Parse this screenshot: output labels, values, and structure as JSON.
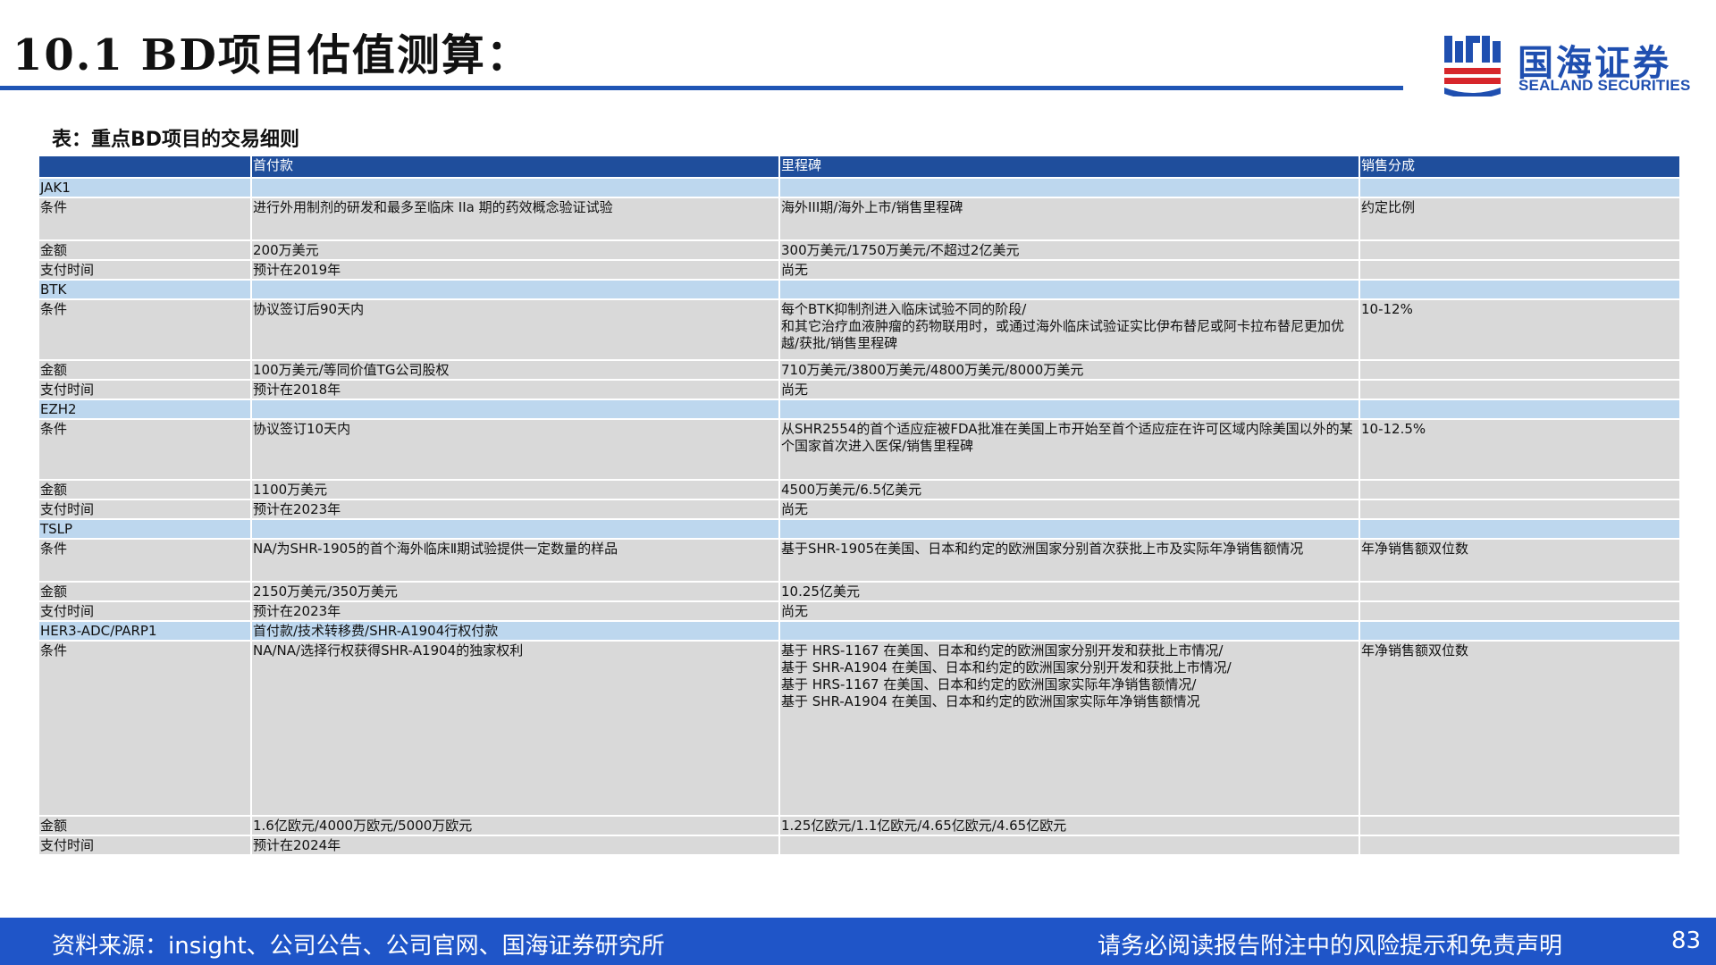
{
  "page": {
    "title": "10.1 BD项目估值测算：",
    "page_number": "83"
  },
  "logo": {
    "cn": "国海证券",
    "en": "SEALAND SECURITIES"
  },
  "table": {
    "caption": "表：重点BD项目的交易细则",
    "headers": [
      "",
      "首付款",
      "里程碑",
      "销售分成"
    ],
    "rows": [
      {
        "kind": "target",
        "cells": [
          "JAK1",
          "",
          "",
          ""
        ]
      },
      {
        "kind": "detail",
        "cells": [
          "条件",
          "进行外用制剂的研发和最多至临床 IIa 期的药效概念验证试验",
          "海外III期/海外上市/销售里程碑",
          "约定比例"
        ]
      },
      {
        "kind": "detail",
        "cells": [
          "金额",
          "200万美元",
          "300万美元/1750万美元/不超过2亿美元",
          ""
        ]
      },
      {
        "kind": "detail",
        "cells": [
          "支付时间",
          "预计在2019年",
          "尚无",
          ""
        ]
      },
      {
        "kind": "target",
        "cells": [
          "BTK",
          "",
          "",
          ""
        ]
      },
      {
        "kind": "detail",
        "cells": [
          "条件",
          "协议签订后90天内",
          "每个BTK抑制剂进入临床试验不同的阶段/\n和其它治疗血液肿瘤的药物联用时，或通过海外临床试验证实比伊布替尼或阿卡拉布替尼更加优越/获批/销售里程碑",
          "10-12%"
        ]
      },
      {
        "kind": "detail",
        "cells": [
          "金额",
          "100万美元/等同价值TG公司股权",
          "710万美元/3800万美元/4800万美元/8000万美元",
          ""
        ]
      },
      {
        "kind": "detail",
        "cells": [
          "支付时间",
          "预计在2018年",
          "尚无",
          ""
        ]
      },
      {
        "kind": "target",
        "cells": [
          "EZH2",
          "",
          "",
          ""
        ]
      },
      {
        "kind": "detail",
        "cells": [
          "条件",
          "协议签订10天内",
          "从SHR2554的首个适应症被FDA批准在美国上市开始至首个适应症在许可区域内除美国以外的某个国家首次进入医保/销售里程碑",
          "10-12.5%"
        ]
      },
      {
        "kind": "detail",
        "cells": [
          "金额",
          "1100万美元",
          "4500万美元/6.5亿美元",
          ""
        ]
      },
      {
        "kind": "detail",
        "cells": [
          "支付时间",
          "预计在2023年",
          "尚无",
          ""
        ]
      },
      {
        "kind": "target",
        "cells": [
          "TSLP",
          "",
          "",
          ""
        ]
      },
      {
        "kind": "detail",
        "cells": [
          "条件",
          "NA/为SHR-1905的首个海外临床Ⅱ期试验提供一定数量的样品",
          "基于SHR-1905在美国、日本和约定的欧洲国家分别首次获批上市及实际年净销售额情况",
          "年净销售额双位数"
        ]
      },
      {
        "kind": "detail",
        "cells": [
          "金额",
          "2150万美元/350万美元",
          "10.25亿美元",
          ""
        ]
      },
      {
        "kind": "detail",
        "cells": [
          "支付时间",
          "预计在2023年",
          "尚无",
          ""
        ]
      },
      {
        "kind": "target",
        "cells": [
          "HER3-ADC/PARP1",
          "首付款/技术转移费/SHR-A1904行权付款",
          "",
          ""
        ]
      },
      {
        "kind": "detail",
        "cells": [
          "条件",
          "NA/NA/选择行权获得SHR-A1904的独家权利",
          "基于 HRS-1167 在美国、日本和约定的欧洲国家分别开发和获批上市情况/\n基于 SHR-A1904 在美国、日本和约定的欧洲国家分别开发和获批上市情况/\n基于 HRS-1167 在美国、日本和约定的欧洲国家实际年净销售额情况/\n基于 SHR-A1904 在美国、日本和约定的欧洲国家实际年净销售额情况",
          "年净销售额双位数"
        ]
      },
      {
        "kind": "detail",
        "cells": [
          "金额",
          "1.6亿欧元/4000万欧元/5000万欧元",
          "1.25亿欧元/1.1亿欧元/4.65亿欧元/4.65亿欧元",
          ""
        ]
      },
      {
        "kind": "detail",
        "cells": [
          "支付时间",
          "预计在2024年",
          "",
          ""
        ]
      }
    ]
  },
  "footer": {
    "source": "资料来源：insight、公司公告、公司官网、国海证券研究所",
    "disclaimer": "请务必阅读报告附注中的风险提示和免责声明"
  },
  "colors": {
    "title_rule": "#1f55b5",
    "header_bg": "#1f4e9c",
    "target_row_bg": "#bdd7ee",
    "detail_row_bg": "#d9d9d9",
    "footer_bg": "#1f55c8",
    "logo_blue": "#1f4fb0",
    "logo_red": "#d7262b"
  }
}
